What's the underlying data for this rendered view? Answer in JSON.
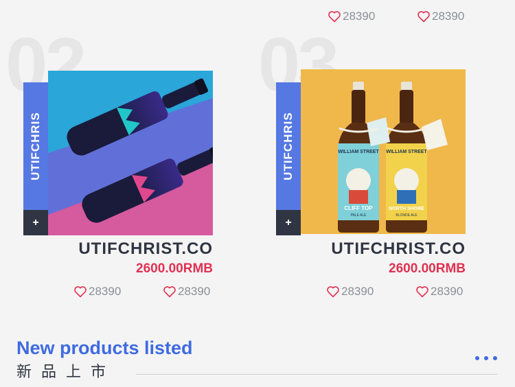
{
  "top_stats": [
    {
      "likes": "28390"
    },
    {
      "likes": "28390"
    }
  ],
  "products": [
    {
      "number": "02",
      "tab_label": "UTIFCHRIS",
      "plus": "+",
      "title": "UTIFCHRIST.CO",
      "price": "2600.00RMB",
      "likes": [
        "28390",
        "28390"
      ],
      "image": "wine-bottles-photo"
    },
    {
      "number": "03",
      "tab_label": "UTIFCHRIS",
      "plus": "+",
      "title": "UTIFCHRIST.CO",
      "price": "2600.00RMB",
      "likes": [
        "28390",
        "28390"
      ],
      "image": "beer-bottles-photo",
      "beer_labels": [
        {
          "brand": "WILLIAM STREET",
          "name": "CLIFF TOP",
          "style": "PALE ALE"
        },
        {
          "brand": "WILLIAM STREET",
          "name": "NORTH SHORE",
          "style": "BLONDE ALE"
        }
      ]
    }
  ],
  "section": {
    "title_en": "New products listed",
    "title_zh": "新品上市"
  },
  "icons": {
    "like": "heart-outline-icon",
    "more": "more-dots-icon"
  },
  "colors": {
    "accent_blue": "#3f6be0",
    "tab_blue": "#5678e2",
    "price_red": "#e03151",
    "heart_red": "#e03151",
    "dark": "#2f3542",
    "background": "#f4f4f4"
  }
}
